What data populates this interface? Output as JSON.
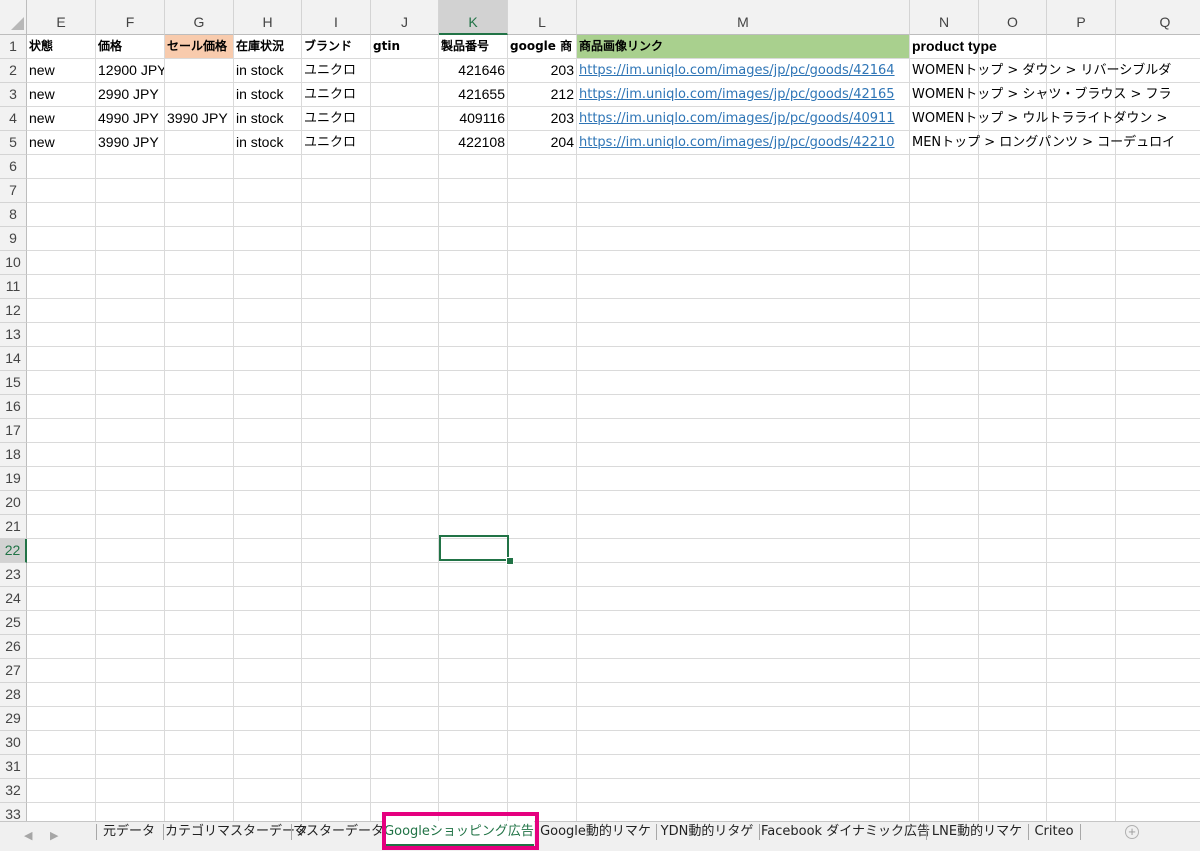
{
  "columns": [
    "E",
    "F",
    "G",
    "H",
    "I",
    "J",
    "K",
    "L",
    "M",
    "N",
    "O",
    "P",
    "Q"
  ],
  "selected_column": "K",
  "selected_row": "22",
  "row_numbers": [
    "1",
    "2",
    "3",
    "4",
    "5",
    "6",
    "7",
    "8",
    "9",
    "10",
    "11",
    "12",
    "13",
    "14",
    "15",
    "16",
    "17",
    "18",
    "19",
    "20",
    "21",
    "22",
    "23",
    "24",
    "25",
    "26",
    "27",
    "28",
    "29",
    "30",
    "31",
    "32",
    "33"
  ],
  "header_row": {
    "E": "状態",
    "F": "価格",
    "G": "セール価格",
    "H": "在庫状況",
    "I": "ブランド",
    "J": "gtin",
    "K": "製品番号",
    "L": "google 商",
    "M": "商品画像リンク",
    "N": "product type"
  },
  "header_fills": {
    "G": "#f8cbad",
    "M": "#a9d08e"
  },
  "rows": [
    {
      "E": "new",
      "F": "12900 JPY",
      "G": "",
      "H": "in stock",
      "I": "ユニクロ",
      "J": "",
      "K": "421646",
      "L": "203",
      "M": "https://im.uniqlo.com/images/jp/pc/goods/42164",
      "N": "WOMENトップ > ダウン > リバーシブルダ"
    },
    {
      "E": "new",
      "F": "2990 JPY",
      "G": "",
      "H": "in stock",
      "I": "ユニクロ",
      "J": "",
      "K": "421655",
      "L": "212",
      "M": "https://im.uniqlo.com/images/jp/pc/goods/42165",
      "N": "WOMENトップ > シャツ・ブラウス > フラ"
    },
    {
      "E": "new",
      "F": "4990 JPY",
      "G": "3990 JPY",
      "H": "in stock",
      "I": "ユニクロ",
      "J": "",
      "K": "409116",
      "L": "203",
      "M": "https://im.uniqlo.com/images/jp/pc/goods/40911",
      "N": "WOMENトップ > ウルトラライトダウン >"
    },
    {
      "E": "new",
      "F": "3990 JPY",
      "G": "",
      "H": "in stock",
      "I": "ユニクロ",
      "J": "",
      "K": "422108",
      "L": "204",
      "M": "https://im.uniqlo.com/images/jp/pc/goods/42210",
      "N": "MENトップ > ロングパンツ > コーデュロイ"
    }
  ],
  "sheet_tabs": [
    "元データ",
    "カテゴリマスターデータ",
    "マスターデータ",
    "Googleショッピング広告",
    "Google動的リマケ",
    "YDN動的リタゲ",
    "Facebook ダイナミック広告",
    "LNE動的リマケ",
    "Criteo"
  ],
  "active_tab": "Googleショッピング広告",
  "colors": {
    "accent_green": "#217346",
    "highlight_magenta": "#e5007f",
    "link_blue": "#2e75b6"
  }
}
